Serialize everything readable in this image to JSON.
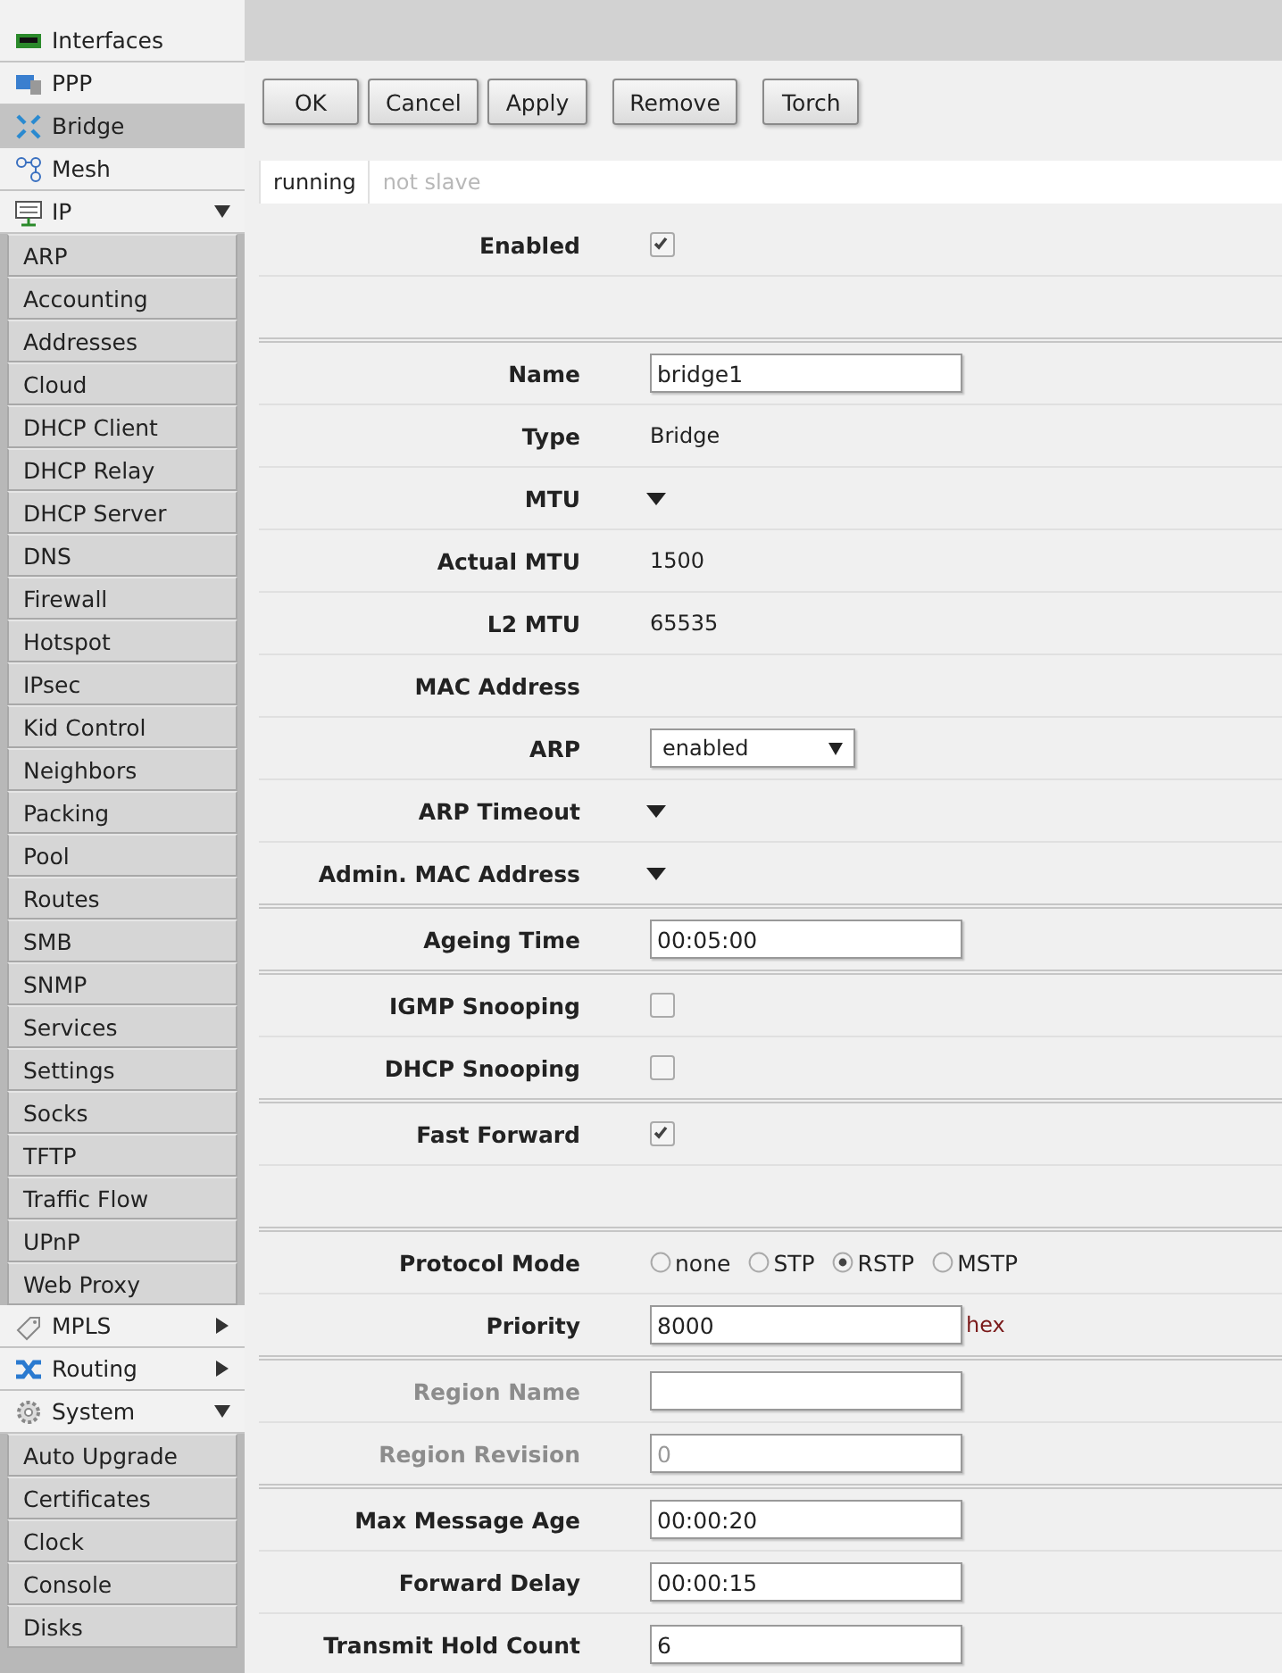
{
  "sidebar": {
    "items": [
      {
        "label": "Interfaces",
        "selected": false
      },
      {
        "label": "PPP",
        "selected": false
      },
      {
        "label": "Bridge",
        "selected": true
      },
      {
        "label": "Mesh",
        "selected": false
      },
      {
        "label": "IP",
        "selected": false,
        "expanded": true,
        "children": [
          {
            "label": "ARP",
            "selected": false
          },
          {
            "label": "Accounting",
            "selected": false
          },
          {
            "label": "Addresses",
            "selected": false
          },
          {
            "label": "Cloud",
            "selected": false
          },
          {
            "label": "DHCP Client",
            "selected": false
          },
          {
            "label": "DHCP Relay",
            "selected": false
          },
          {
            "label": "DHCP Server",
            "selected": false
          },
          {
            "label": "DNS",
            "selected": false
          },
          {
            "label": "Firewall",
            "selected": false
          },
          {
            "label": "Hotspot",
            "selected": false
          },
          {
            "label": "IPsec",
            "selected": false
          },
          {
            "label": "Kid Control",
            "selected": false
          },
          {
            "label": "Neighbors",
            "selected": false
          },
          {
            "label": "Packing",
            "selected": false
          },
          {
            "label": "Pool",
            "selected": false
          },
          {
            "label": "Routes",
            "selected": false
          },
          {
            "label": "SMB",
            "selected": false
          },
          {
            "label": "SNMP",
            "selected": false
          },
          {
            "label": "Services",
            "selected": false
          },
          {
            "label": "Settings",
            "selected": false
          },
          {
            "label": "Socks",
            "selected": false
          },
          {
            "label": "TFTP",
            "selected": false
          },
          {
            "label": "Traffic Flow",
            "selected": false
          },
          {
            "label": "UPnP",
            "selected": false
          },
          {
            "label": "Web Proxy",
            "selected": false
          }
        ]
      },
      {
        "label": "MPLS",
        "selected": false,
        "expanded": false
      },
      {
        "label": "Routing",
        "selected": false,
        "expanded": false
      },
      {
        "label": "System",
        "selected": false,
        "expanded": true,
        "children": [
          {
            "label": "Auto Upgrade",
            "selected": false
          },
          {
            "label": "Certificates",
            "selected": false
          },
          {
            "label": "Clock",
            "selected": false
          },
          {
            "label": "Console",
            "selected": false
          },
          {
            "label": "Disks",
            "selected": false
          }
        ]
      }
    ]
  },
  "toolbar": {
    "groups": [
      [
        "OK",
        "Cancel",
        "Apply"
      ],
      [
        "Remove"
      ],
      [
        "Torch"
      ]
    ]
  },
  "status": [
    {
      "label": "running",
      "disabled": false
    },
    {
      "label": "not slave",
      "disabled": true
    }
  ],
  "sections": [
    {
      "rows": [
        {
          "kind": "checkbox",
          "label": "Enabled",
          "disabled": false,
          "checked": true
        },
        {
          "kind": "blank"
        }
      ]
    },
    {
      "rows": [
        {
          "kind": "input",
          "label": "Name",
          "disabled": false,
          "value": "bridge1"
        },
        {
          "kind": "text",
          "label": "Type",
          "disabled": false,
          "value": "Bridge"
        },
        {
          "kind": "toggle",
          "label": "MTU",
          "disabled": false
        },
        {
          "kind": "text",
          "label": "Actual MTU",
          "disabled": false,
          "value": "1500"
        },
        {
          "kind": "text",
          "label": "L2 MTU",
          "disabled": false,
          "value": "65535"
        },
        {
          "kind": "text",
          "label": "MAC Address",
          "disabled": false
        },
        {
          "kind": "select",
          "label": "ARP",
          "disabled": false,
          "value": "enabled"
        },
        {
          "kind": "toggle",
          "label": "ARP Timeout",
          "disabled": false
        },
        {
          "kind": "toggle",
          "label": "Admin. MAC Address",
          "disabled": false
        }
      ]
    },
    {
      "rows": [
        {
          "kind": "input",
          "label": "Ageing Time",
          "disabled": false,
          "value": "00:05:00"
        }
      ]
    },
    {
      "rows": [
        {
          "kind": "checkbox",
          "label": "IGMP Snooping",
          "disabled": false,
          "checked": false
        },
        {
          "kind": "checkbox",
          "label": "DHCP Snooping",
          "disabled": false,
          "checked": false
        }
      ]
    },
    {
      "rows": [
        {
          "kind": "checkbox",
          "label": "Fast Forward",
          "disabled": false,
          "checked": true
        },
        {
          "kind": "blank"
        }
      ]
    },
    {
      "rows": [
        {
          "kind": "radio",
          "label": "Protocol Mode",
          "disabled": false,
          "options": [
            {
              "label": "none",
              "selected": false
            },
            {
              "label": "STP",
              "selected": false
            },
            {
              "label": "RSTP",
              "selected": true
            },
            {
              "label": "MSTP",
              "selected": false
            }
          ]
        },
        {
          "kind": "input",
          "label": "Priority",
          "disabled": false,
          "value": "8000",
          "suffix": "hex"
        }
      ]
    },
    {
      "rows": [
        {
          "kind": "input",
          "label": "Region Name",
          "disabled": true
        },
        {
          "kind": "input",
          "label": "Region Revision",
          "disabled": true,
          "value": "0"
        }
      ]
    },
    {
      "rows": [
        {
          "kind": "input",
          "label": "Max Message Age",
          "disabled": false,
          "value": "00:00:20"
        },
        {
          "kind": "input",
          "label": "Forward Delay",
          "disabled": false,
          "value": "00:00:15"
        },
        {
          "kind": "input",
          "label": "Transmit Hold Count",
          "disabled": false,
          "value": "6"
        }
      ]
    }
  ]
}
